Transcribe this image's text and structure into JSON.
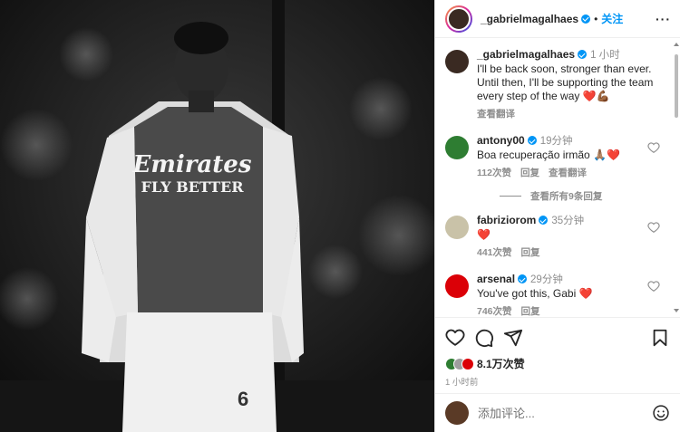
{
  "post": {
    "username": "_gabrielmagalhaes",
    "dot": "•",
    "follow_label": "关注",
    "more_label": "···"
  },
  "photo": {
    "jersey_sponsor_1": "Emirates",
    "jersey_sponsor_2": "FLY BETTER",
    "number": "6"
  },
  "caption": {
    "username": "_gabrielmagalhaes",
    "time": "1 小时",
    "text": "I'll be back soon, stronger than ever. Until then, I'll be supporting the team every step of the way ❤️💪🏾",
    "translate": "查看翻译"
  },
  "comments": [
    {
      "username": "antony00",
      "time": "19分钟",
      "text": "Boa recuperação irmão 🙏🏽❤️",
      "likes": "112次赞",
      "reply": "回复",
      "translate": "查看翻译",
      "avatar_color": "#2e7d32"
    },
    {
      "username": "fabriziorom",
      "time": "35分钟",
      "text": "❤️",
      "likes": "441次赞",
      "reply": "回复",
      "translate": "",
      "avatar_color": "#c9c2a8"
    },
    {
      "username": "arsenal",
      "time": "29分钟",
      "text": "You've got this, Gabi ❤️",
      "likes": "746次赞",
      "reply": "回复",
      "translate": "",
      "avatar_color": "#db0007"
    }
  ],
  "view_replies": "查看所有9条回复",
  "stats": {
    "likes": "8.1万次赞",
    "ago": "1 小时前"
  },
  "add_comment": {
    "placeholder": "添加评论..."
  },
  "colors": {
    "accent": "#0095f6",
    "heart": "#ed4956"
  }
}
